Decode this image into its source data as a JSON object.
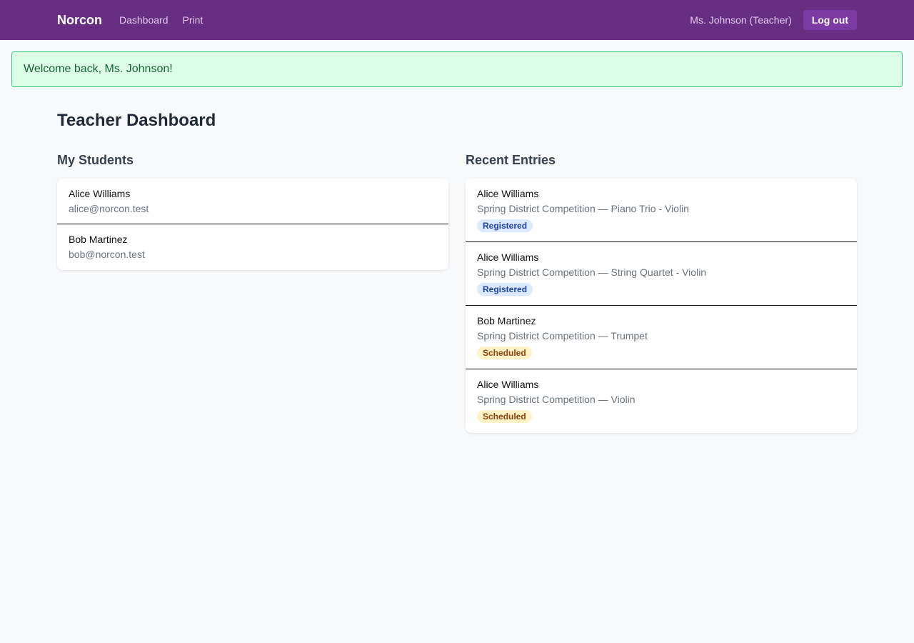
{
  "navbar": {
    "brand": "Norcon",
    "links": [
      {
        "label": "Dashboard"
      },
      {
        "label": "Print"
      }
    ],
    "user": "Ms. Johnson (Teacher)",
    "logout_label": "Log out"
  },
  "flash": {
    "message": "Welcome back, Ms. Johnson!"
  },
  "page": {
    "title": "Teacher Dashboard"
  },
  "students": {
    "title": "My Students",
    "items": [
      {
        "name": "Alice Williams",
        "email": "alice@norcon.test"
      },
      {
        "name": "Bob Martinez",
        "email": "bob@norcon.test"
      }
    ]
  },
  "entries": {
    "title": "Recent Entries",
    "items": [
      {
        "student": "Alice Williams",
        "detail": "Spring District Competition — Piano Trio - Violin",
        "status": "Registered"
      },
      {
        "student": "Alice Williams",
        "detail": "Spring District Competition — String Quartet - Violin",
        "status": "Registered"
      },
      {
        "student": "Bob Martinez",
        "detail": "Spring District Competition — Trumpet",
        "status": "Scheduled"
      },
      {
        "student": "Alice Williams",
        "detail": "Spring District Competition — Violin",
        "status": "Scheduled"
      }
    ]
  },
  "colors": {
    "navbar": "#662d83",
    "registered_badge": "#dbeafe",
    "scheduled_badge": "#fef3c7",
    "flash_bg": "#dcfce7"
  }
}
